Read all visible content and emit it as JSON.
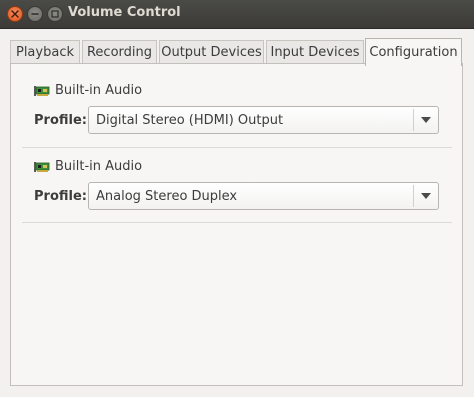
{
  "window": {
    "title": "Volume Control"
  },
  "tabs": [
    {
      "label": "Playback",
      "active": false
    },
    {
      "label": "Recording",
      "active": false
    },
    {
      "label": "Output Devices",
      "active": false
    },
    {
      "label": "Input Devices",
      "active": false
    },
    {
      "label": "Configuration",
      "active": true
    }
  ],
  "cards": [
    {
      "name": "Built-in Audio",
      "icon": "sound-card-icon",
      "profile_label": "Profile:",
      "profile_value": "Digital Stereo (HDMI) Output"
    },
    {
      "name": "Built-in Audio",
      "icon": "sound-card-icon",
      "profile_label": "Profile:",
      "profile_value": "Analog Stereo Duplex"
    }
  ],
  "colors": {
    "titlebar": "#3c3b37",
    "close_button": "#e0561f",
    "window_bg": "#f2f1f0"
  }
}
